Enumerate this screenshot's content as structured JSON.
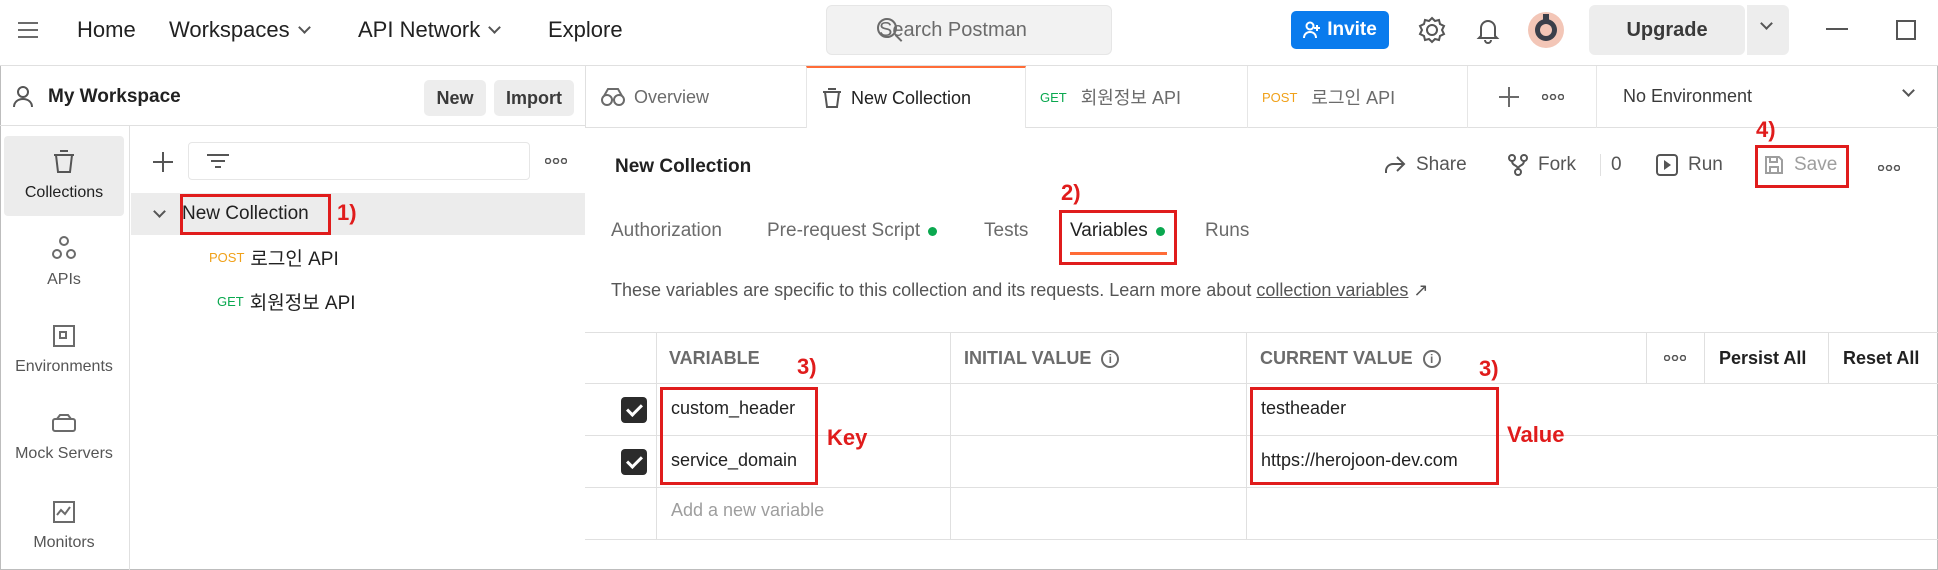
{
  "topbar": {
    "nav": [
      "Home",
      "Workspaces",
      "API Network",
      "Explore"
    ],
    "search_placeholder": "Search Postman",
    "invite": "Invite",
    "upgrade": "Upgrade",
    "accent": "#097bed"
  },
  "workspace": {
    "title": "My Workspace",
    "new": "New",
    "import": "Import"
  },
  "rail": [
    "Collections",
    "APIs",
    "Environments",
    "Mock Servers",
    "Monitors"
  ],
  "tree": {
    "collection": "New Collection",
    "items": [
      {
        "method": "POST",
        "name": "로그인 API"
      },
      {
        "method": "GET",
        "name": "회원정보 API"
      }
    ]
  },
  "tabs": {
    "overview": "Overview",
    "active": "New Collection",
    "t1_method": "GET",
    "t1_name": "회원정보 API",
    "t2_method": "POST",
    "t2_name": "로그인 API",
    "environment": "No Environment"
  },
  "collection": {
    "title": "New Collection",
    "share": "Share",
    "fork": "Fork",
    "fork_count": "0",
    "run": "Run",
    "save": "Save"
  },
  "subtabs": [
    "Authorization",
    "Pre-request Script",
    "Tests",
    "Variables",
    "Runs"
  ],
  "description": {
    "text": "These variables are specific to this collection and its requests. Learn more about ",
    "link": "collection variables",
    "arrow": "↗"
  },
  "table": {
    "headers": {
      "variable": "VARIABLE",
      "initial": "INITIAL VALUE",
      "current": "CURRENT VALUE",
      "persist": "Persist All",
      "reset": "Reset All"
    },
    "rows": [
      {
        "variable": "custom_header",
        "initial": "",
        "current": "testheader"
      },
      {
        "variable": "service_domain",
        "initial": "",
        "current": "https://herojoon-dev.com"
      }
    ],
    "add_placeholder": "Add a new variable"
  },
  "annotations": {
    "a1": "1)",
    "a2": "2)",
    "a3a": "3)",
    "a3b": "3)",
    "a4": "4)",
    "key": "Key",
    "value": "Value",
    "color": "#e01c1c"
  }
}
